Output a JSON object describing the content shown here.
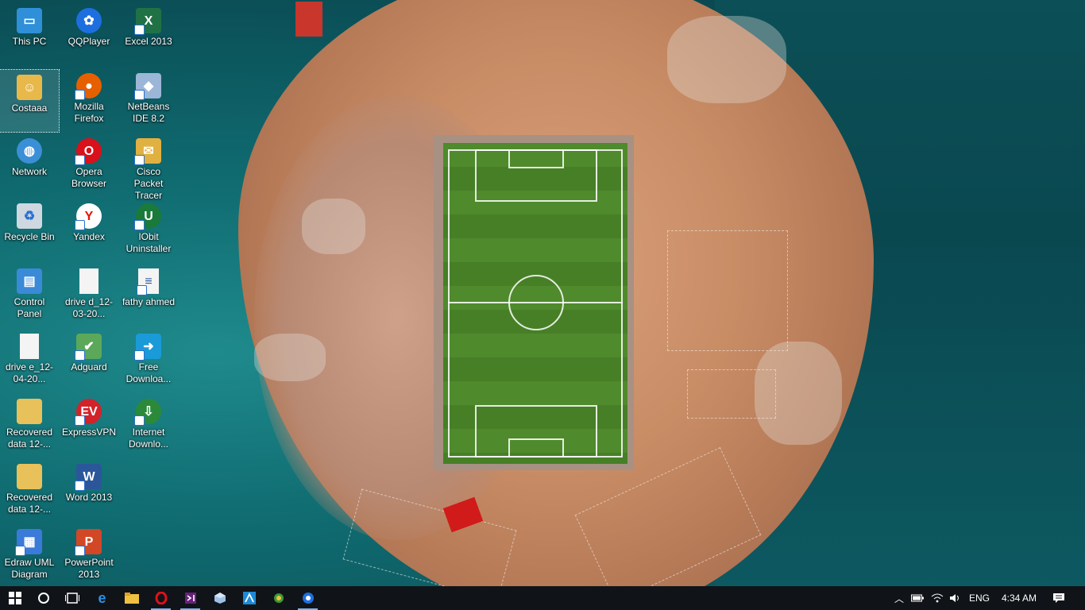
{
  "desktop": {
    "icons": [
      {
        "label": "This PC",
        "glyph": "computer-icon",
        "color": "#2f8fd8"
      },
      {
        "label": "QQPlayer",
        "glyph": "qqplayer-icon",
        "color": "#1d6fe0"
      },
      {
        "label": "Excel 2013",
        "glyph": "excel-icon",
        "color": "#207245"
      },
      {
        "label": "Costaaa",
        "glyph": "user-folder-icon",
        "color": "#e8b84a"
      },
      {
        "label": "Mozilla Firefox",
        "glyph": "firefox-icon",
        "color": "#e66000"
      },
      {
        "label": "NetBeans IDE 8.2",
        "glyph": "netbeans-icon",
        "color": "#9bb6d6"
      },
      {
        "label": "Network",
        "glyph": "network-icon",
        "color": "#3b8fd6"
      },
      {
        "label": "Opera Browser",
        "glyph": "opera-icon",
        "color": "#d8111b"
      },
      {
        "label": "Cisco Packet Tracer",
        "glyph": "cisco-packet-tracer-icon",
        "color": "#e0b040"
      },
      {
        "label": "Recycle Bin",
        "glyph": "recycle-bin-icon",
        "color": "#cfd8e0"
      },
      {
        "label": "Yandex",
        "glyph": "yandex-icon",
        "color": "#ffffff"
      },
      {
        "label": "IObit Uninstaller",
        "glyph": "iobit-uninstaller-icon",
        "color": "#1a7a3a"
      },
      {
        "label": "Control Panel",
        "glyph": "control-panel-icon",
        "color": "#3a8ad8"
      },
      {
        "label": "drive d_12-03-20...",
        "glyph": "file-icon",
        "color": "#f4f4f4"
      },
      {
        "label": "fathy ahmed",
        "glyph": "document-icon",
        "color": "#f4f4f4"
      },
      {
        "label": "drive e_12-04-20...",
        "glyph": "file-icon",
        "color": "#f4f4f4"
      },
      {
        "label": "Adguard",
        "glyph": "adguard-icon",
        "color": "#5ba85a"
      },
      {
        "label": "Free Downloa...",
        "glyph": "free-download-manager-icon",
        "color": "#1a9ad8"
      },
      {
        "label": "Recovered data 12-...",
        "glyph": "folder-icon",
        "color": "#e8c15a"
      },
      {
        "label": "ExpressVPN",
        "glyph": "expressvpn-icon",
        "color": "#d2232a"
      },
      {
        "label": "Internet Downlo...",
        "glyph": "internet-download-manager-icon",
        "color": "#2a8a3a"
      },
      {
        "label": "Recovered data 12-...",
        "glyph": "folder-icon",
        "color": "#e8c15a"
      },
      {
        "label": "Word 2013",
        "glyph": "word-icon",
        "color": "#2b579a"
      },
      {
        "label": "Edraw UML Diagram",
        "glyph": "edraw-uml-icon",
        "color": "#3a7ad8"
      },
      {
        "label": "PowerPoint 2013",
        "glyph": "powerpoint-icon",
        "color": "#d24726"
      }
    ]
  },
  "taskbar": {
    "apps": [
      {
        "name": "start-button",
        "symbol": "⊞"
      },
      {
        "name": "cortana-button",
        "symbol": "○"
      },
      {
        "name": "task-view-button",
        "symbol": "❐"
      },
      {
        "name": "edge-taskbar-icon",
        "symbol": "e"
      },
      {
        "name": "file-explorer-taskbar-icon",
        "symbol": "▬"
      },
      {
        "name": "opera-taskbar-icon",
        "symbol": "O"
      },
      {
        "name": "visual-studio-taskbar-icon",
        "symbol": "⋈"
      },
      {
        "name": "netbeans-taskbar-icon",
        "symbol": "◆"
      },
      {
        "name": "azure-taskbar-icon",
        "symbol": "A"
      },
      {
        "name": "cisco-taskbar-icon",
        "symbol": "✦"
      },
      {
        "name": "qqplayer-taskbar-icon",
        "symbol": "✿"
      }
    ],
    "tray": {
      "language": "ENG",
      "time": "4:34 AM"
    }
  }
}
